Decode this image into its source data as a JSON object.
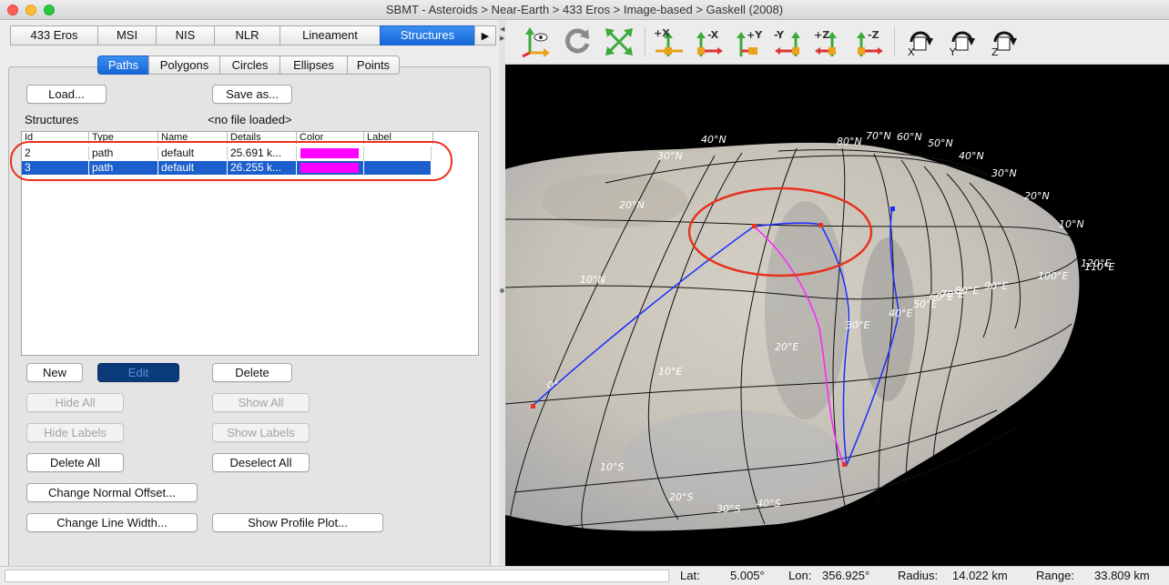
{
  "window": {
    "title": "SBMT - Asteroids > Near-Earth > 433 Eros > Image-based > Gaskell (2008)"
  },
  "top_tabs": [
    {
      "label": "433 Eros",
      "selected": false
    },
    {
      "label": "MSI",
      "selected": false
    },
    {
      "label": "NIS",
      "selected": false
    },
    {
      "label": "NLR",
      "selected": false
    },
    {
      "label": "Lineament",
      "selected": false
    },
    {
      "label": "Structures",
      "selected": true
    }
  ],
  "top_tabs_more_icon": "triangle-right-icon",
  "sub_tabs": [
    {
      "label": "Paths",
      "selected": true
    },
    {
      "label": "Polygons",
      "selected": false
    },
    {
      "label": "Circles",
      "selected": false
    },
    {
      "label": "Ellipses",
      "selected": false
    },
    {
      "label": "Points",
      "selected": false
    }
  ],
  "file": {
    "load_label": "Load...",
    "save_label": "Save as...",
    "structures_label": "Structures",
    "file_status": "<no file loaded>"
  },
  "table": {
    "columns": [
      "Id",
      "Type",
      "Name",
      "Details",
      "Color",
      "Label"
    ],
    "rows": [
      {
        "id": "2",
        "type": "path",
        "name": "default",
        "details": "25.691 k...",
        "color": "#ff00ff",
        "label": "",
        "selected": false
      },
      {
        "id": "3",
        "type": "path",
        "name": "default",
        "details": "26.255 k...",
        "color": "#ff00ff",
        "label": "",
        "selected": true
      }
    ]
  },
  "buttons": {
    "new": "New",
    "edit": "Edit",
    "delete": "Delete",
    "hide_all": "Hide All",
    "show_all": "Show All",
    "hide_labels": "Hide Labels",
    "show_labels": "Show Labels",
    "delete_all": "Delete All",
    "deselect_all": "Deselect All",
    "change_normal_offset": "Change Normal Offset...",
    "change_line_width": "Change Line Width...",
    "show_profile_plot": "Show Profile Plot..."
  },
  "toolbar": {
    "buttons": [
      {
        "icon": "view-orientation-icon"
      },
      {
        "icon": "reset-rotation-icon"
      },
      {
        "icon": "fit-view-icon"
      },
      {
        "icon": "view-plus-x-icon",
        "text": "+X"
      },
      {
        "icon": "view-minus-x-icon",
        "text": "-X"
      },
      {
        "icon": "view-plus-y-icon",
        "text": "+Y"
      },
      {
        "icon": "view-minus-y-icon",
        "text": "-Y"
      },
      {
        "icon": "view-plus-z-icon",
        "text": "+Z"
      },
      {
        "icon": "view-minus-z-icon",
        "text": "-Z"
      },
      {
        "icon": "rotate-x-icon",
        "text": "X"
      },
      {
        "icon": "rotate-y-icon",
        "text": "Y"
      },
      {
        "icon": "rotate-z-icon",
        "text": "Z"
      }
    ]
  },
  "grid_labels": {
    "lat": [
      "40°N",
      "30°N",
      "20°N",
      "10°N",
      "0°",
      "10°S",
      "20°S",
      "30°S",
      "40°S",
      "80°N",
      "70°N",
      "60°N",
      "50°N",
      "40°N",
      "30°N",
      "20°N",
      "10°N"
    ],
    "lon": [
      "10°E",
      "20°E",
      "30°E",
      "40°E",
      "50°E",
      "60°E",
      "70°E",
      "80°E",
      "90°E",
      "100°E",
      "110°E",
      "120°E"
    ]
  },
  "colors": {
    "accent": "#1c5fcc",
    "path_blue": "#1a2cff",
    "path_magenta": "#ff22ff",
    "annotation_red": "#e8321e"
  },
  "status_bar": {
    "lat_label": "Lat:",
    "lat_value": "5.005°",
    "lon_label": "Lon:",
    "lon_value": "356.925°",
    "radius_label": "Radius:",
    "radius_value": "14.022 km",
    "range_label": "Range:",
    "range_value": "33.809 km"
  }
}
